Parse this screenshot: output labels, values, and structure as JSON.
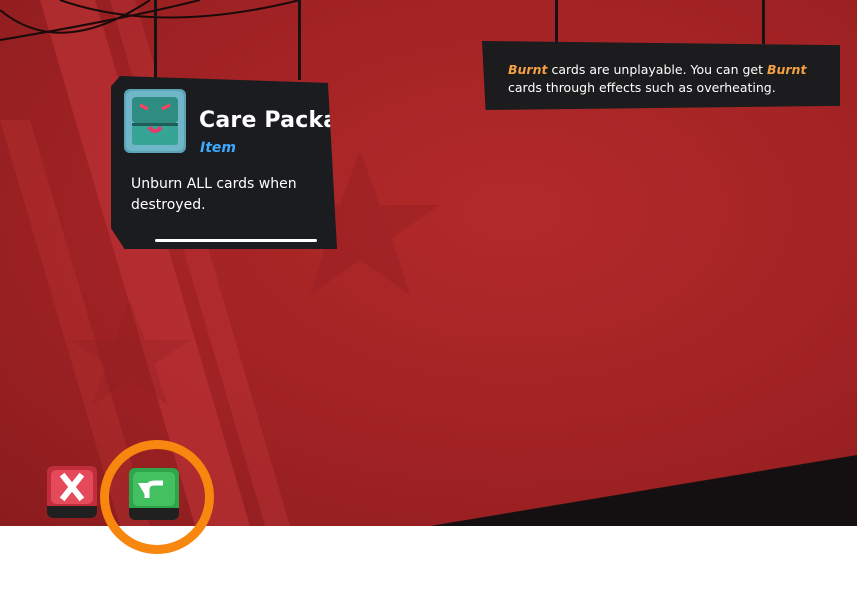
{
  "item_card": {
    "title": "Care Package",
    "type": "Item",
    "description": "Unburn ALL cards when destroyed.",
    "icon": "treasure-chest-icon"
  },
  "tooltip": {
    "keyword_1": "Burnt",
    "text_1": " cards are unplayable. You can get ",
    "keyword_2": "Burnt",
    "text_2": " cards through effects such as overheating."
  },
  "buttons": {
    "cancel_icon": "close-icon",
    "back_icon": "return-arrow-icon"
  },
  "colors": {
    "background": "#a12224",
    "keyword": "#f4a042",
    "item_type": "#3fa8ff",
    "cancel": "#e44a5a",
    "back": "#43c05f",
    "highlight": "#f7870f"
  }
}
